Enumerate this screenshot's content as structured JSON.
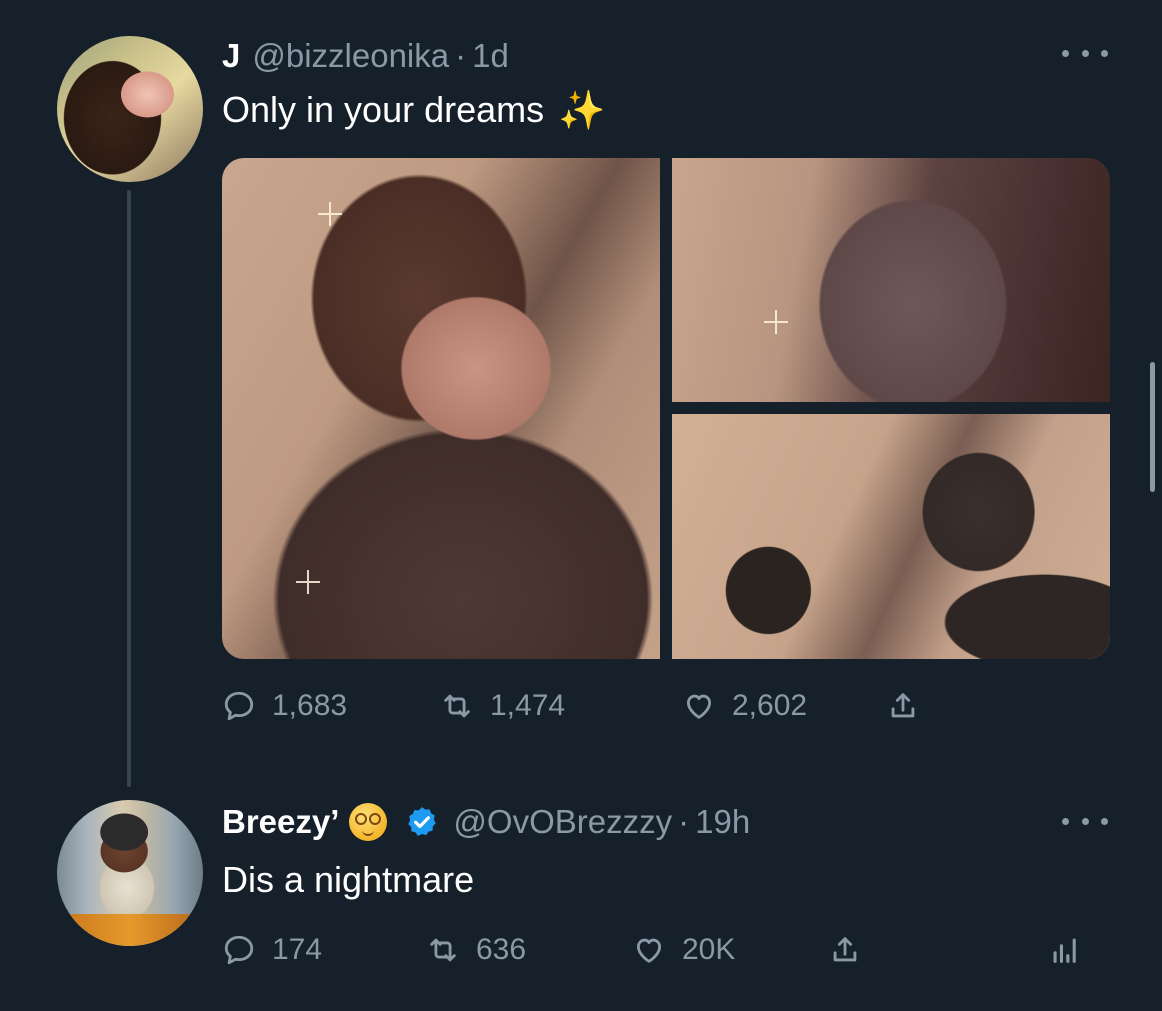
{
  "tweet1": {
    "display_name": "J",
    "handle": "@bizzleonika",
    "separator": "·",
    "time": "1d",
    "text": "Only in your dreams",
    "emoji": "✨",
    "actions": {
      "replies": "1,683",
      "retweets": "1,474",
      "likes": "2,602"
    }
  },
  "tweet2": {
    "display_name": "Breezy’",
    "handle": "@OvOBrezzzy",
    "separator": "·",
    "time": "19h",
    "text": "Dis a nightmare",
    "actions": {
      "replies": "174",
      "retweets": "636",
      "likes": "20K"
    }
  },
  "colors": {
    "background": "#15202b",
    "secondary_text": "#8b98a5",
    "verified": "#1d9bf0"
  }
}
